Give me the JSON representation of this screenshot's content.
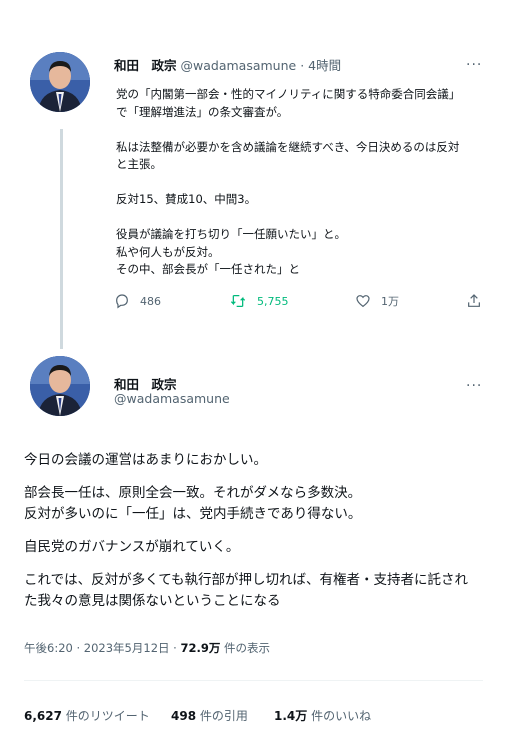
{
  "tweet1": {
    "name": "和田　政宗",
    "handle": "@wadamasamune",
    "dot": "·",
    "time": "4時間",
    "more": "···",
    "lines": [
      "党の「内閣第一部会・性的マイノリティに関する特命委合同会議」",
      "で「理解増進法」の条文審査が。",
      "私は法整備が必要かを含め議論を継続すべき、今日決めるのは反対",
      "と主張。",
      "反対15、賛成10、中間3。",
      "役員が議論を打ち切り「一任願いたい」と。",
      "私や何人もが反対。",
      "その中、部会長が「一任された」と"
    ],
    "actions": {
      "reply": "486",
      "retweet": "5,755",
      "like": "1万"
    }
  },
  "tweet2": {
    "name": "和田　政宗",
    "handle": "@wadamasamune",
    "more": "···",
    "lines": [
      "今日の会議の運営はあまりにおかしい。",
      "部会長一任は、原則全会一致。それがダメなら多数決。",
      "反対が多いのに「一任」は、党内手続きであり得ない。",
      "自民党のガバナンスが崩れていく。",
      "これでは、反対が多くても執行部が押し切れば、有権者・支持者に託され",
      "た我々の意見は関係ないということになる"
    ],
    "timestamp": "午後6:20 · 2023年5月12日",
    "dot": "·",
    "views": "72.9万",
    "views_label": "件の表示",
    "stats": {
      "retweets": "6,627",
      "retweets_label": "件のリツイート",
      "quotes": "498",
      "quotes_label": "件の引用",
      "likes": "1.4万",
      "likes_label": "件のいいね"
    }
  },
  "colors": {
    "text": "#0f1419",
    "secondary": "#536471",
    "retweet_green": "#00ba7c",
    "thread_line": "#cfd9de"
  }
}
